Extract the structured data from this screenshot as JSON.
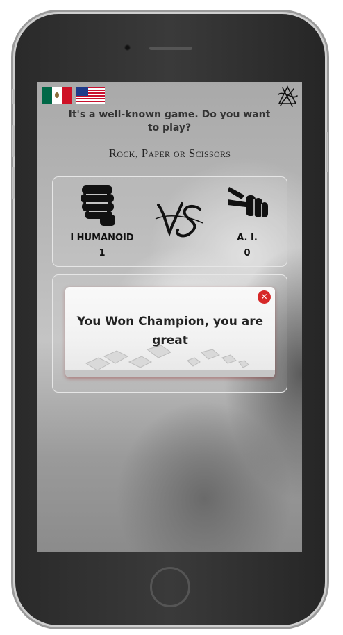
{
  "language_flags": [
    {
      "name": "mexico-flag",
      "colors": [
        "#006847",
        "#ffffff",
        "#ce1126"
      ]
    },
    {
      "name": "usa-flag",
      "colors": [
        "#c8102e",
        "#ffffff",
        "#1e3a8a"
      ]
    }
  ],
  "header": {
    "intro": "It's a well-known game. Do you want to play?",
    "subtitle": "Rock, Paper or Scissors"
  },
  "scoreboard": {
    "human": {
      "name": "I HUMANOID",
      "score": "1",
      "hand_icon": "fist-icon"
    },
    "ai": {
      "name": "A. I.",
      "score": "0",
      "hand_icon": "scissors-hand-icon"
    },
    "vs_icon": "vs-icon"
  },
  "result": {
    "message": "You Won Champion, you are great",
    "close_icon": "close-icon"
  },
  "colors": {
    "close_button": "#d62828",
    "text": "#222222",
    "panel_border": "#e6e6e6"
  }
}
